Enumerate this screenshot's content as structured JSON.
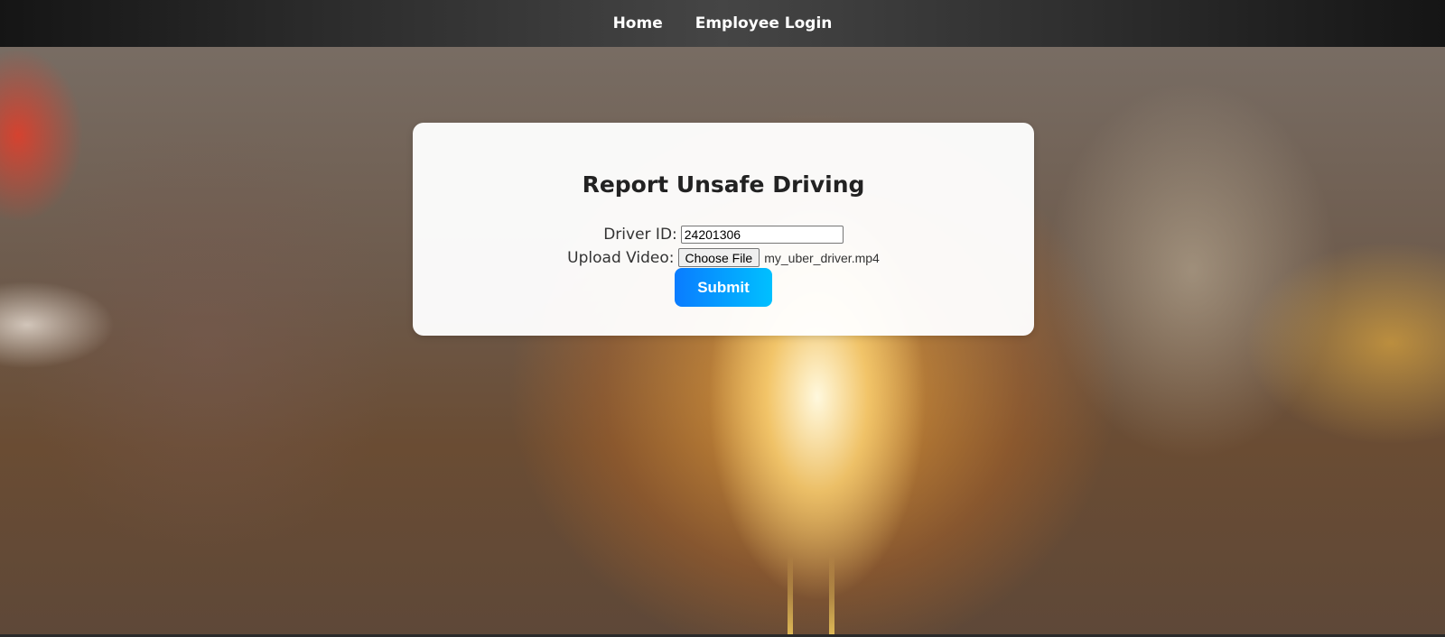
{
  "nav": {
    "items": [
      {
        "label": "Home"
      },
      {
        "label": "Employee Login"
      }
    ]
  },
  "form": {
    "title": "Report Unsafe Driving",
    "driver_id_label": "Driver ID:",
    "driver_id_value": "24201306",
    "upload_label": "Upload Video:",
    "choose_file_label": "Choose File",
    "file_name": "my_uber_driver.mp4",
    "submit_label": "Submit"
  },
  "colors": {
    "navbar": "#2e2e2e",
    "submit_gradient_start": "#0a7cff",
    "submit_gradient_end": "#00c0ff",
    "card_background": "#ffffff"
  }
}
